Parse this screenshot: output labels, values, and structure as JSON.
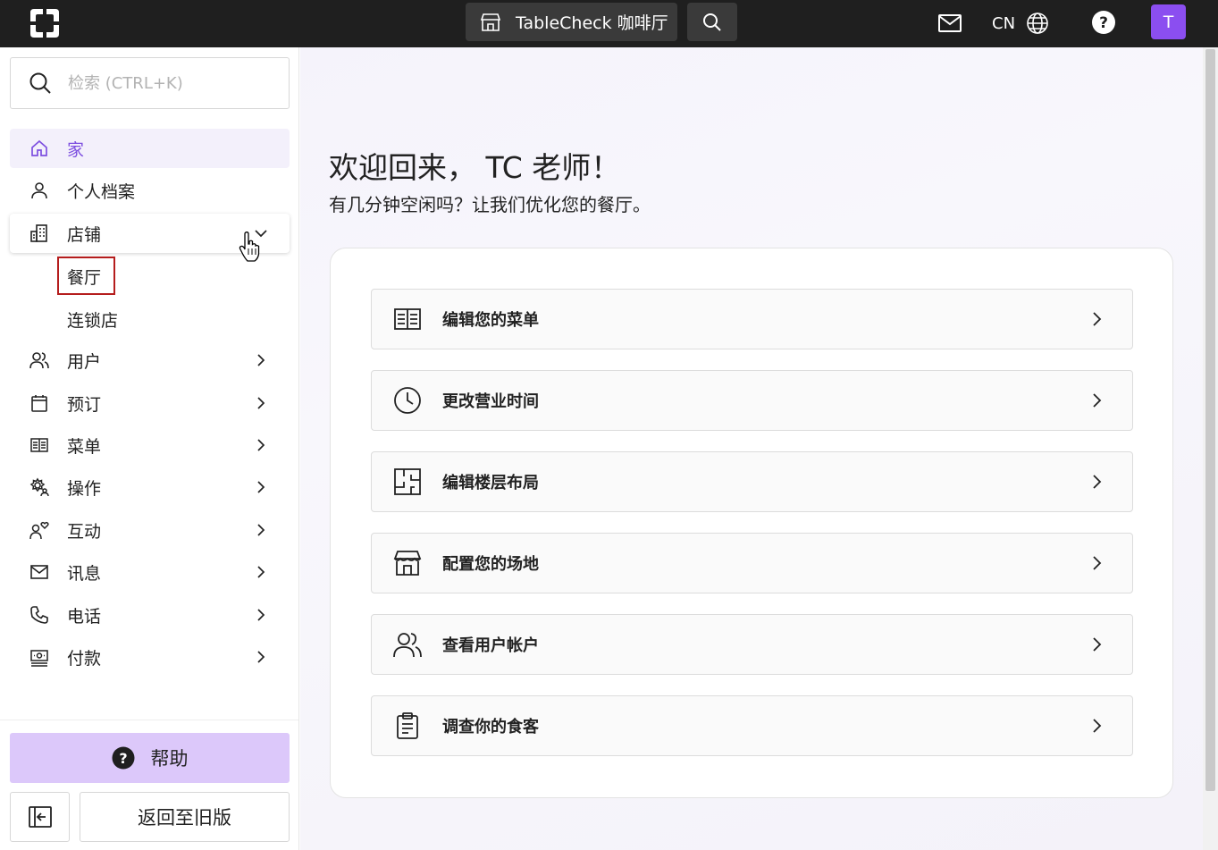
{
  "topbar": {
    "venue_label": "TableCheck 咖啡厅",
    "lang_label": "CN",
    "avatar_initial": "T",
    "accent_color": "#8b4ef0"
  },
  "sidebar": {
    "search_placeholder": "检索 (CTRL+K)",
    "items": [
      {
        "label": "家",
        "icon": "home-icon"
      },
      {
        "label": "个人档案",
        "icon": "person-icon"
      },
      {
        "label": "店铺",
        "icon": "building-icon"
      },
      {
        "label": "用户",
        "icon": "users-icon"
      },
      {
        "label": "预订",
        "icon": "calendar-icon"
      },
      {
        "label": "菜单",
        "icon": "menu-book-icon"
      },
      {
        "label": "操作",
        "icon": "gear-person-icon"
      },
      {
        "label": "互动",
        "icon": "person-heart-icon"
      },
      {
        "label": "讯息",
        "icon": "mail-icon"
      },
      {
        "label": "电话",
        "icon": "phone-icon"
      },
      {
        "label": "付款",
        "icon": "cash-icon"
      }
    ],
    "sub_items": [
      "餐厅",
      "连锁店"
    ],
    "help_label": "帮助",
    "legacy_label": "返回至旧版"
  },
  "main": {
    "welcome": "欢迎回来， TC 老师！",
    "subtitle": "有几分钟空闲吗？让我们优化您的餐厅。",
    "actions": [
      {
        "label": "编辑您的菜单",
        "icon": "menu-book-icon"
      },
      {
        "label": "更改营业时间",
        "icon": "clock-icon"
      },
      {
        "label": "编辑楼层布局",
        "icon": "floor-plan-icon"
      },
      {
        "label": "配置您的场地",
        "icon": "storefront-icon"
      },
      {
        "label": "查看用户帐户",
        "icon": "users-icon"
      },
      {
        "label": "调查你的食客",
        "icon": "clipboard-icon"
      }
    ]
  }
}
